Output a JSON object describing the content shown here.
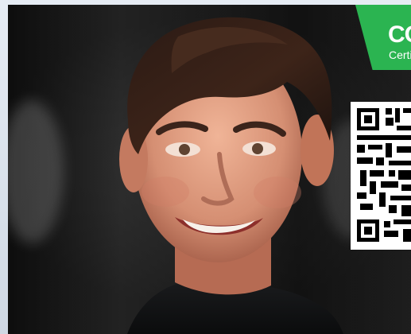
{
  "badge": {
    "title": "CO",
    "subtitle": "Certif",
    "color": "#2bb451"
  },
  "qr_code": {
    "icon": "qr-code-icon"
  },
  "photo": {
    "subject": "portrait-photo"
  }
}
